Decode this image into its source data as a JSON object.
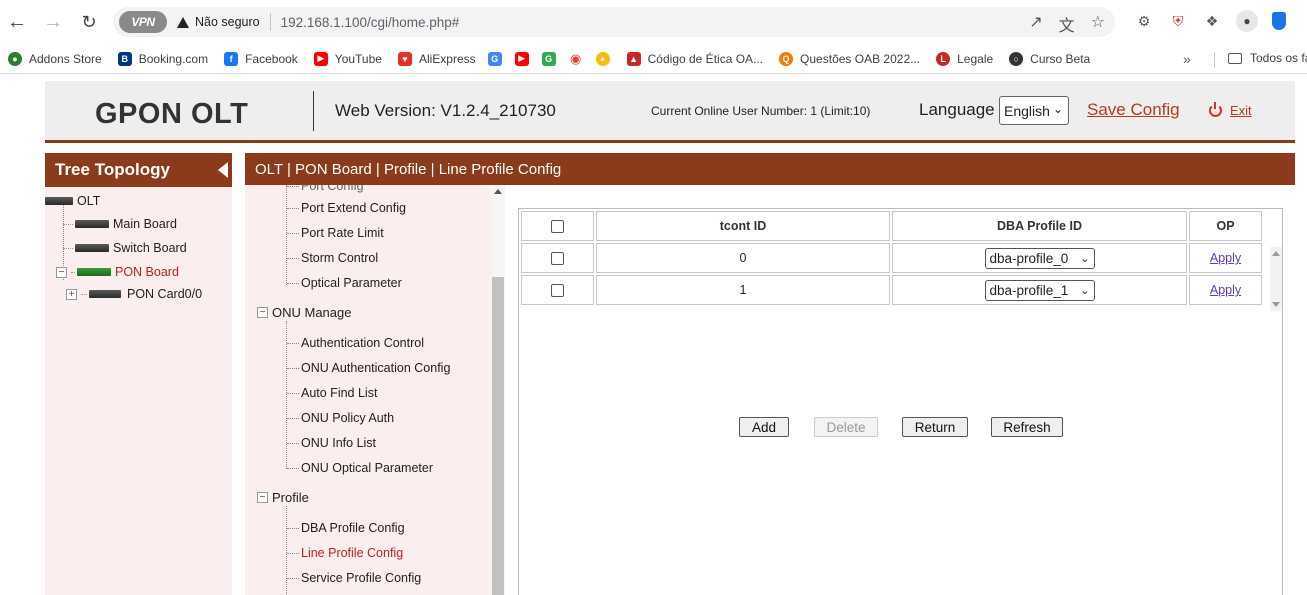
{
  "browser": {
    "vpn_label": "VPN",
    "security_label": "Não seguro",
    "url": "192.168.1.100/cgi/home.php#",
    "avatar_icon": "person-icon"
  },
  "bookmarks": [
    {
      "label": "Addons Store",
      "color": "#2e7d32"
    },
    {
      "label": "Booking.com",
      "color": "#003580"
    },
    {
      "label": "Facebook",
      "color": "#1877f2"
    },
    {
      "label": "YouTube",
      "color": "#ff0000"
    },
    {
      "label": "AliExpress",
      "color": "#e43225"
    },
    {
      "label": "Código de Ética OA...",
      "color": "#c62828"
    },
    {
      "label": "Questões OAB 2022...",
      "color": "#f57c00"
    },
    {
      "label": "Legale",
      "color": "#c62828"
    },
    {
      "label": "Curso Beta",
      "color": "#333333"
    }
  ],
  "bookmarks_folder": "Todos os fa",
  "header": {
    "brand": "GPON OLT",
    "version": "Web Version: V1.2.4_210730",
    "online_users": "Current Online User Number: 1 (Limit:10)",
    "language_label": "Language",
    "language_value": "English",
    "save_config": "Save Config",
    "exit": "Exit"
  },
  "tree": {
    "title": "Tree Topology",
    "root": "OLT",
    "main_board": "Main Board",
    "switch_board": "Switch Board",
    "pon_board": "PON Board",
    "pon_card": "PON Card0/0"
  },
  "breadcrumb": "OLT | PON Board | Profile | Line Profile Config",
  "menu": {
    "port_config_partial": "Port Config",
    "port_extend": "Port Extend Config",
    "port_rate": "Port Rate Limit",
    "storm": "Storm Control",
    "optical": "Optical Parameter",
    "onu_manage": "ONU Manage",
    "auth_control": "Authentication Control",
    "onu_auth_config": "ONU Authentication Config",
    "auto_find": "Auto Find List",
    "onu_policy": "ONU Policy Auth",
    "onu_info": "ONU Info List",
    "onu_optical": "ONU Optical Parameter",
    "profile": "Profile",
    "dba_profile": "DBA Profile Config",
    "line_profile": "Line Profile Config",
    "service_profile": "Service Profile Config"
  },
  "table": {
    "headers": {
      "tcont": "tcont ID",
      "dba": "DBA Profile ID",
      "op": "OP"
    },
    "rows": [
      {
        "tcont": "0",
        "dba": "dba-profile_0",
        "op": "Apply"
      },
      {
        "tcont": "1",
        "dba": "dba-profile_1",
        "op": "Apply"
      }
    ]
  },
  "buttons": {
    "add": "Add",
    "delete": "Delete",
    "return": "Return",
    "refresh": "Refresh"
  },
  "colors": {
    "accent": "#8b3a1c",
    "active": "#c0211e",
    "link": "#5b3cc4"
  }
}
